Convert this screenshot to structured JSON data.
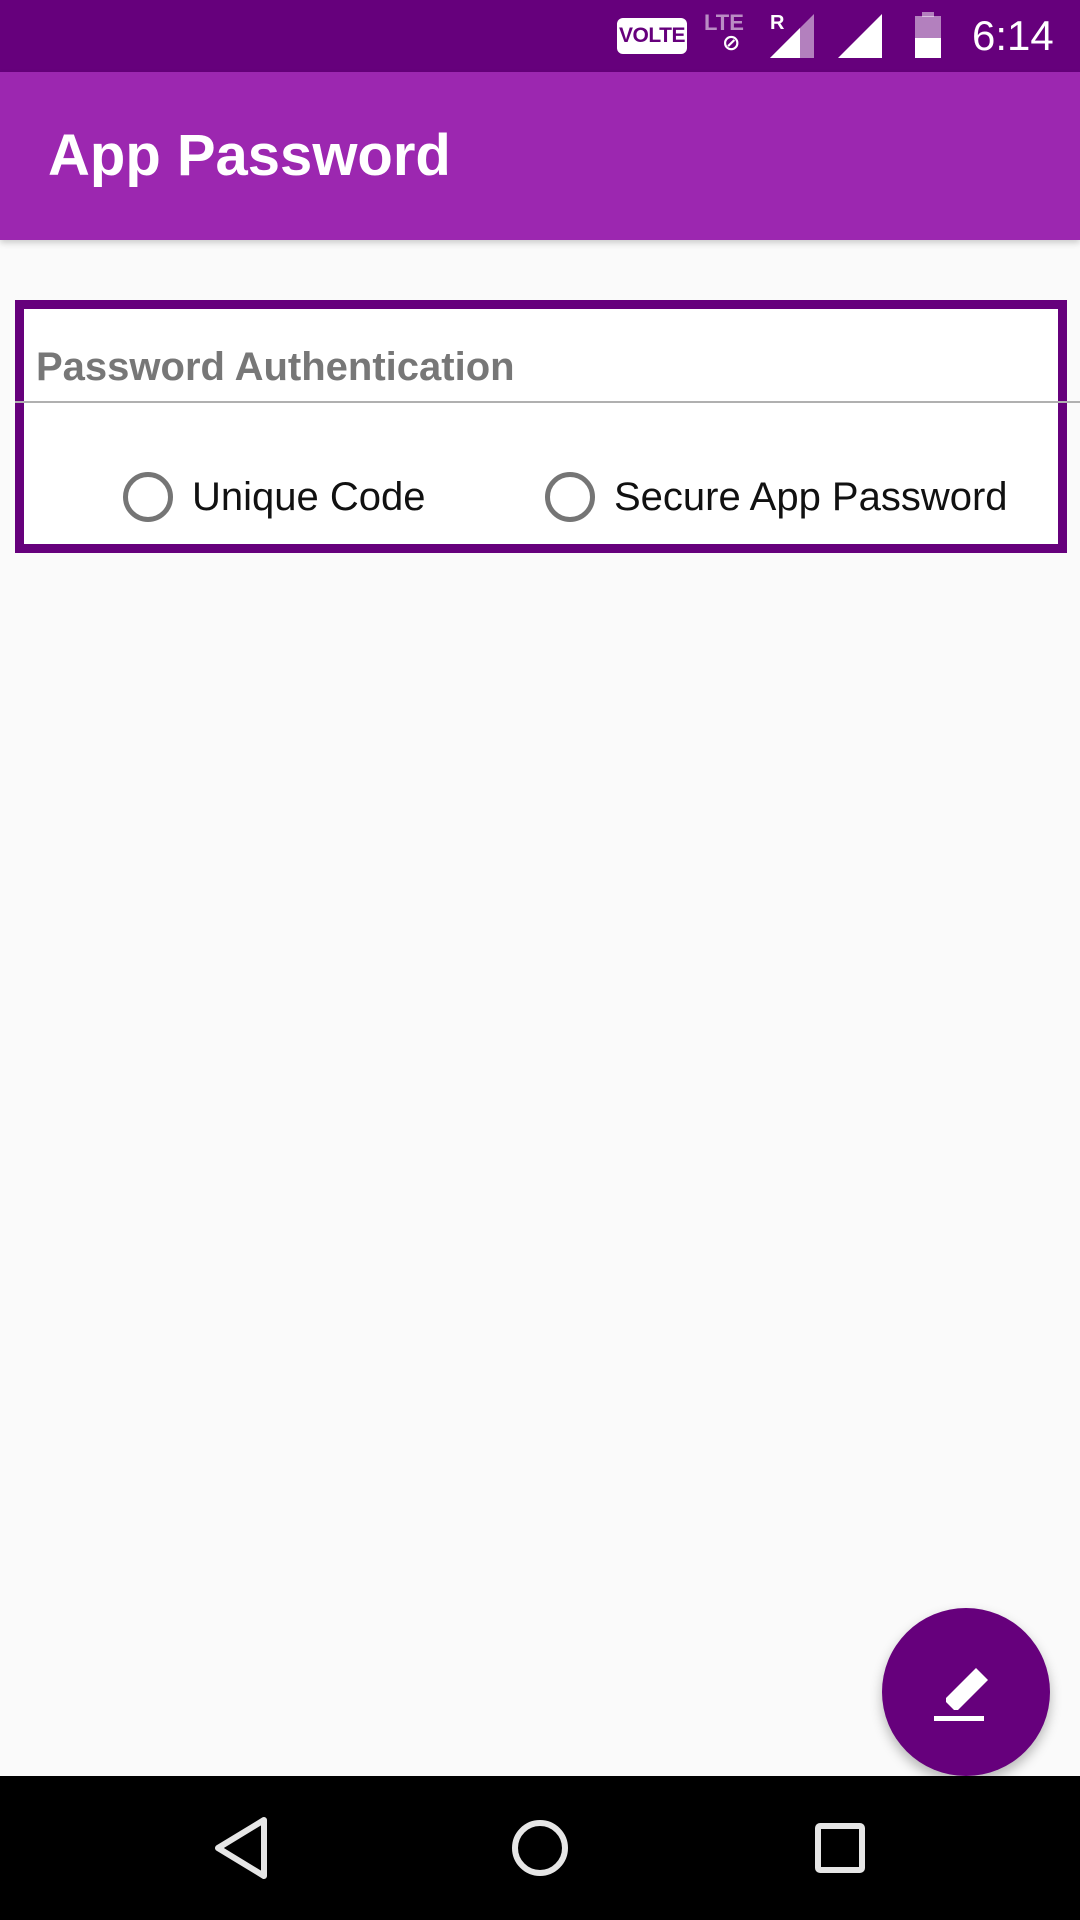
{
  "status_bar": {
    "volte": "VOLTE",
    "network": "LTE",
    "roaming": "R",
    "time": "6:14",
    "icons": [
      "volte-icon",
      "lte-blocked-icon",
      "signal-roaming-icon",
      "signal-icon",
      "battery-icon"
    ]
  },
  "app_bar": {
    "title": "App Password"
  },
  "auth_card": {
    "title": "Password Authentication",
    "options": [
      {
        "label": "Unique Code",
        "selected": false
      },
      {
        "label": "Secure App Password",
        "selected": false
      }
    ]
  },
  "fab": {
    "icon": "edit-icon"
  },
  "nav_bar": {
    "icons": [
      "back-icon",
      "home-icon",
      "recents-icon"
    ]
  },
  "colors": {
    "status_bar": "#66007c",
    "app_bar": "#9c27b0",
    "card_border": "#66007c",
    "fab": "#66007c",
    "nav_bar": "#000000",
    "background": "#fafafa"
  }
}
